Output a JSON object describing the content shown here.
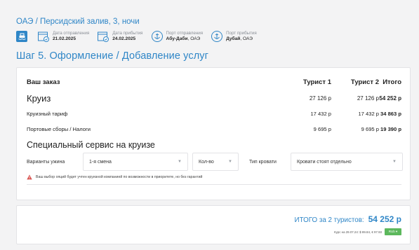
{
  "header": {
    "route": "ОАЭ / Персидский залив, 3, ночи",
    "departure_date_label": "Дата отправления",
    "departure_date": "21.02.2025",
    "arrival_date_label": "Дата прибытия",
    "arrival_date": "24.02.2025",
    "departure_port_label": "Порт отправления",
    "departure_port_city": "Абу-Даби",
    "departure_port_country": ", ОАЭ",
    "arrival_port_label": "Порт прибытия",
    "arrival_port_city": "Дубай",
    "arrival_port_country": ", ОАЭ"
  },
  "step_title": "Шаг 5. Оформление / Добавление услуг",
  "order": {
    "columns": [
      "Ваш заказ",
      "Турист 1",
      "Турист 2",
      "Итого"
    ],
    "rows": [
      {
        "name": "Круиз",
        "t1": "27 126 р",
        "t2": "27 126 р",
        "total": "54 252 р"
      },
      {
        "name": "Круизный тариф",
        "t1": "17 432 р",
        "t2": "17 432 р",
        "total": "34 863 р"
      },
      {
        "name": "Портовые сборы / Налоги",
        "t1": "9 695 р",
        "t2": "9 695 р",
        "total": "19 390 р"
      }
    ]
  },
  "special": {
    "title": "Специальный сервис на круизе",
    "dinner_label": "Варианты ужина",
    "dinner_value": "1-я смена",
    "qty_value": "Кол-во",
    "bed_label": "Тип кровати",
    "bed_value": "Кровати стоят отдельно",
    "warning": "Ваш выбор опций будет учтен круизной компанией по возможности в приоритете, но без гарантий"
  },
  "total": {
    "label": "ИТОГО за 2 туристов:",
    "value": "54 252 р",
    "rate": "Курс на 29.07.24: $ 89.84, € 97.93",
    "currency": "RUb ▾"
  },
  "colors": {
    "accent": "#2f86c7",
    "warning": "#d9534f",
    "currency_button": "#5cb85c"
  },
  "icons": [
    "ship-icon",
    "calendar-icon",
    "anchor-icon",
    "chevron-down-icon",
    "warning-icon"
  ]
}
